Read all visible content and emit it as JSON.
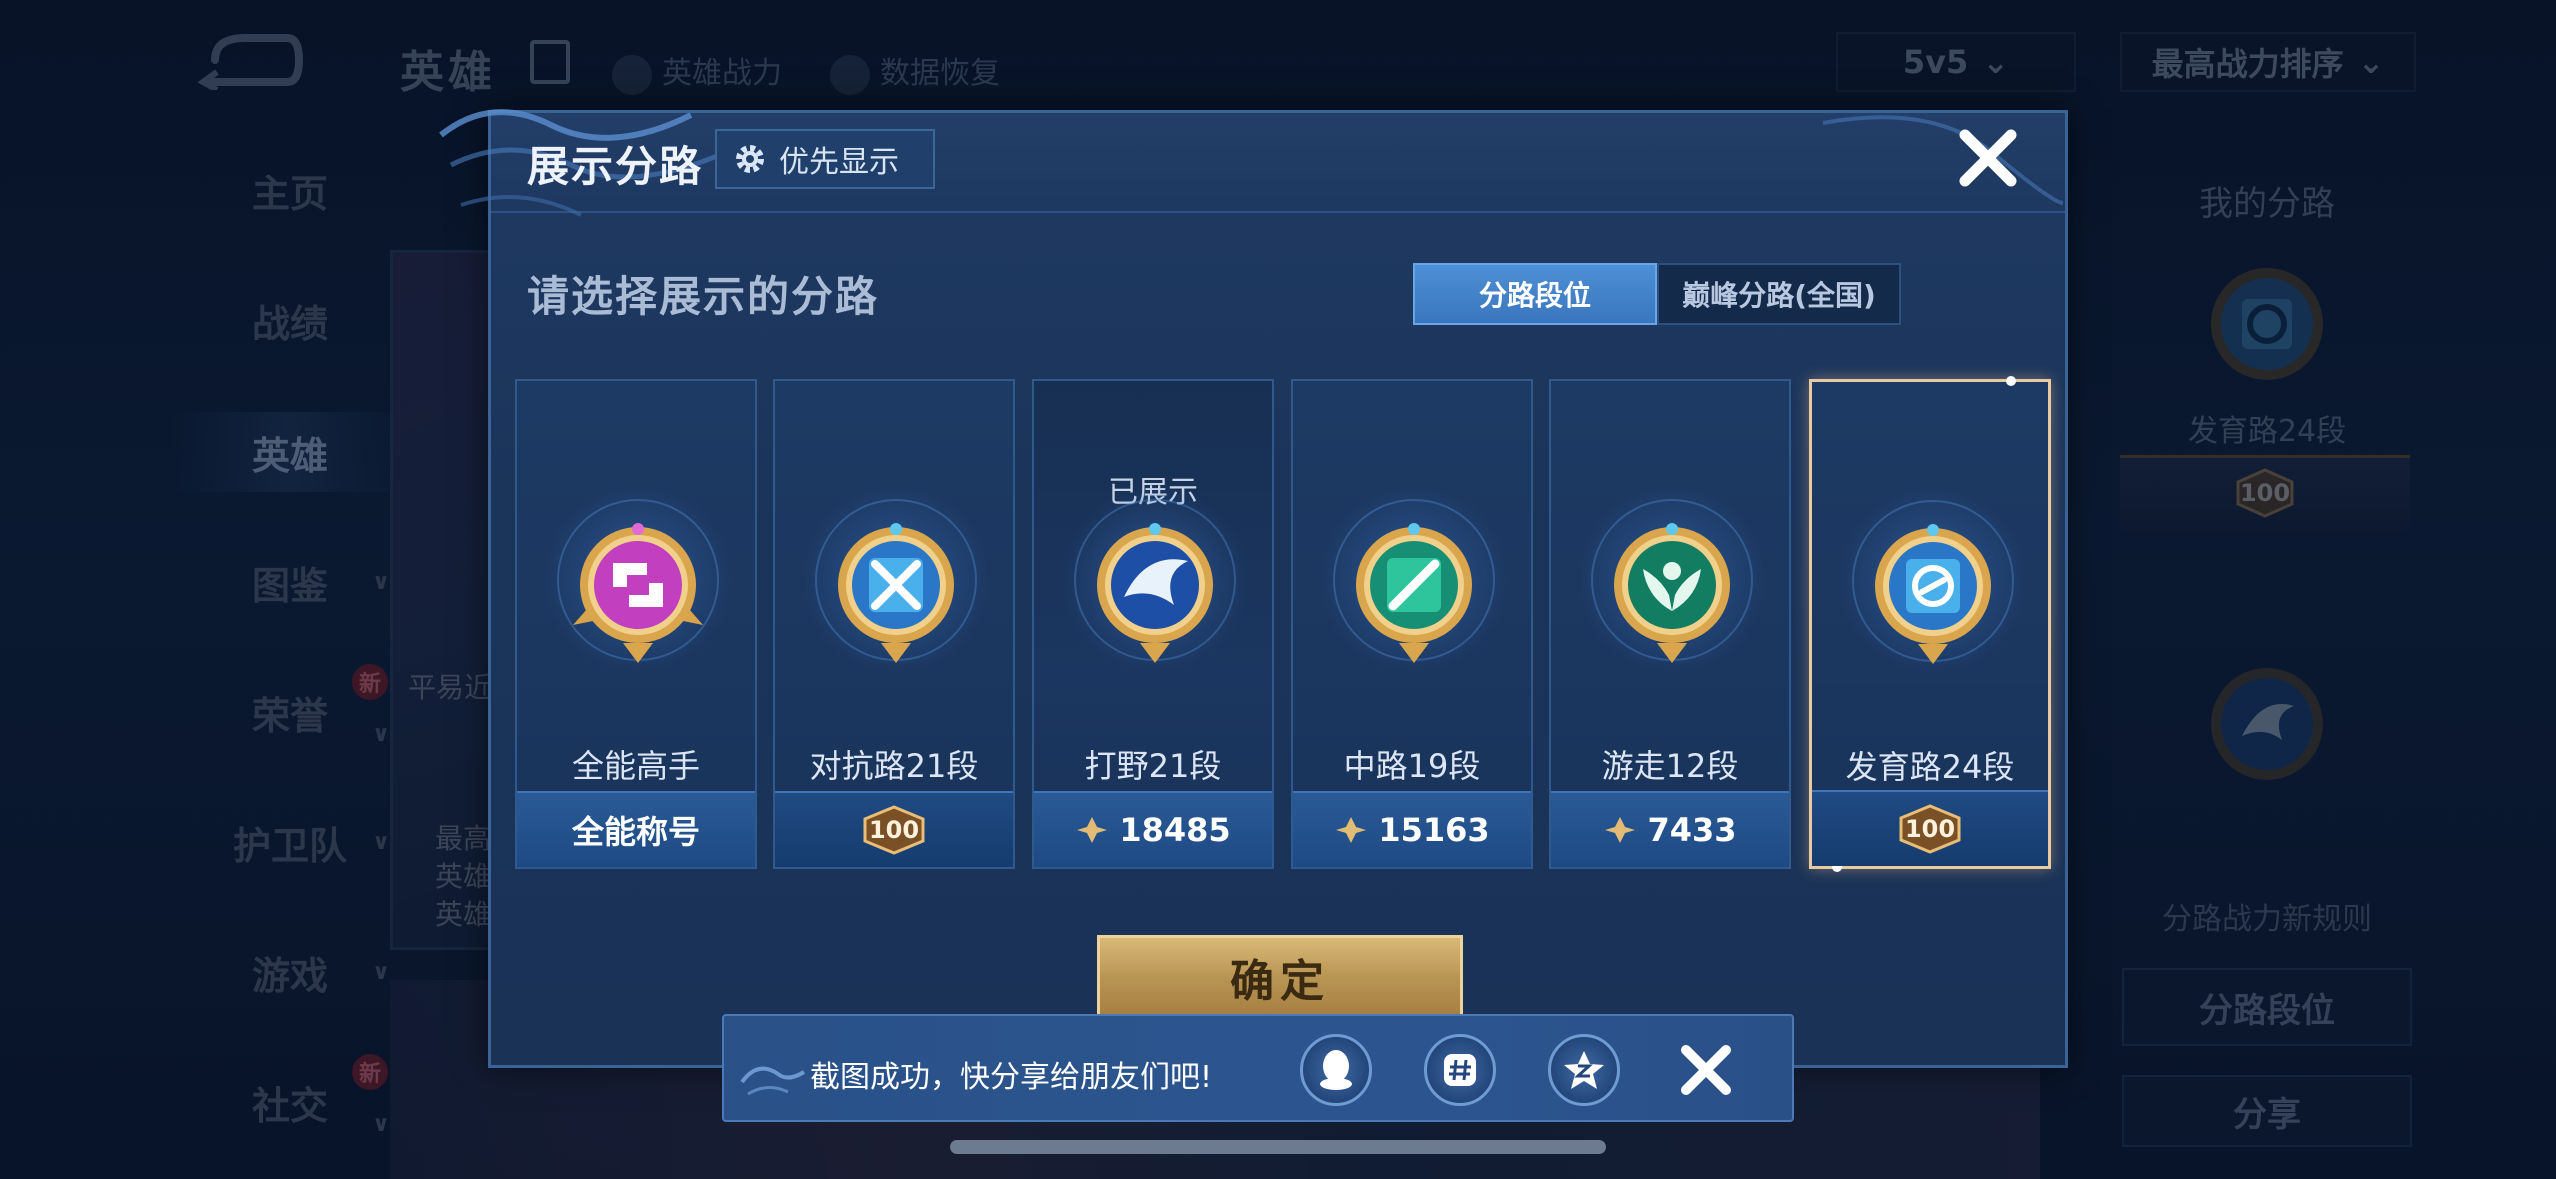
{
  "background": {
    "top_title": "英雄",
    "top_links": [
      "英雄战力",
      "数据恢复"
    ],
    "mode_select": "5v5",
    "sort_select": "最高战力排序",
    "side_nav": [
      {
        "label": "主页"
      },
      {
        "label": "战绩"
      },
      {
        "label": "英雄"
      },
      {
        "label": "图鉴"
      },
      {
        "label": "荣誉"
      },
      {
        "label": "护卫队"
      },
      {
        "label": "游戏"
      },
      {
        "label": "社交"
      }
    ],
    "new_badge": "新",
    "hero_card_text": "平易近",
    "hero_card_lines": [
      "最高",
      "英雄",
      "英雄"
    ],
    "right_panel": {
      "title": "我的分路",
      "rank_label": "发育路24段",
      "badge": "100",
      "rule_text": "分路战力新规则",
      "btn_rank": "分路段位",
      "btn_share": "分享"
    }
  },
  "modal": {
    "title": "展示分路",
    "priority_button": "优先显示",
    "subtitle": "请选择展示的分路",
    "segment": {
      "active": "分路段位",
      "inactive": "巅峰分路(全国)"
    },
    "cards": [
      {
        "label": "全能高手",
        "status": "",
        "footer": "全能称号",
        "emblem": "allround-emblem-icon",
        "color": "#c23fc0"
      },
      {
        "label": "对抗路21段",
        "status": "",
        "footer": "100",
        "emblem": "clash-lane-emblem-icon",
        "color": "#2f8fe0"
      },
      {
        "label": "打野21段",
        "status": "已展示",
        "footer": "18485",
        "emblem": "jungle-emblem-icon",
        "color": "#2a63c8"
      },
      {
        "label": "中路19段",
        "status": "",
        "footer": "15163",
        "emblem": "mid-lane-emblem-icon",
        "color": "#1fae8c"
      },
      {
        "label": "游走12段",
        "status": "",
        "footer": "7433",
        "emblem": "roam-emblem-icon",
        "color": "#1e9a78"
      },
      {
        "label": "发育路24段",
        "status": "",
        "footer": "100",
        "emblem": "farm-lane-emblem-icon",
        "color": "#2f8fe0"
      }
    ],
    "confirm": "确定"
  },
  "toast": {
    "text": "截图成功，快分享给朋友们吧!",
    "share_targets": [
      "qq-icon",
      "wechat-moments-icon",
      "qzone-icon"
    ]
  }
}
